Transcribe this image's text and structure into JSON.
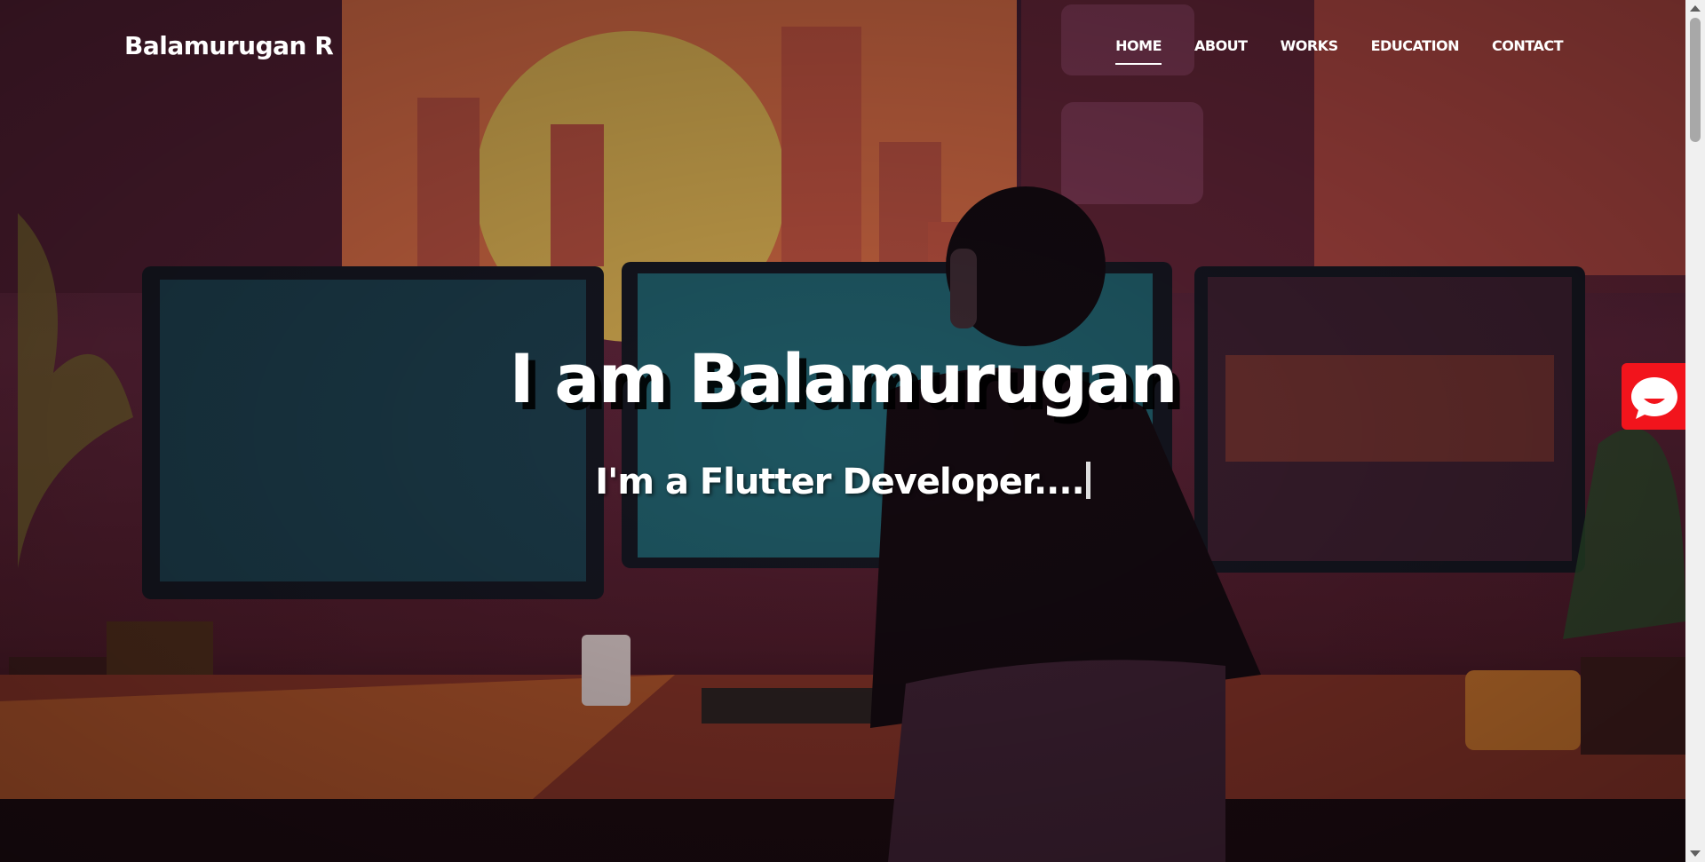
{
  "brand": {
    "name": "Balamurugan R"
  },
  "nav": {
    "items": [
      {
        "label": "HOME",
        "active": true
      },
      {
        "label": "ABOUT",
        "active": false
      },
      {
        "label": "WORKS",
        "active": false
      },
      {
        "label": "EDUCATION",
        "active": false
      },
      {
        "label": "CONTACT",
        "active": false
      }
    ]
  },
  "hero": {
    "headline": "I am Balamurugan",
    "typed_text": "I'm a Flutter Developer...."
  },
  "chat": {
    "icon": "chat-bubble-icon",
    "color": "#f2141c"
  },
  "colors": {
    "text": "#ffffff",
    "accent": "#f2141c"
  }
}
